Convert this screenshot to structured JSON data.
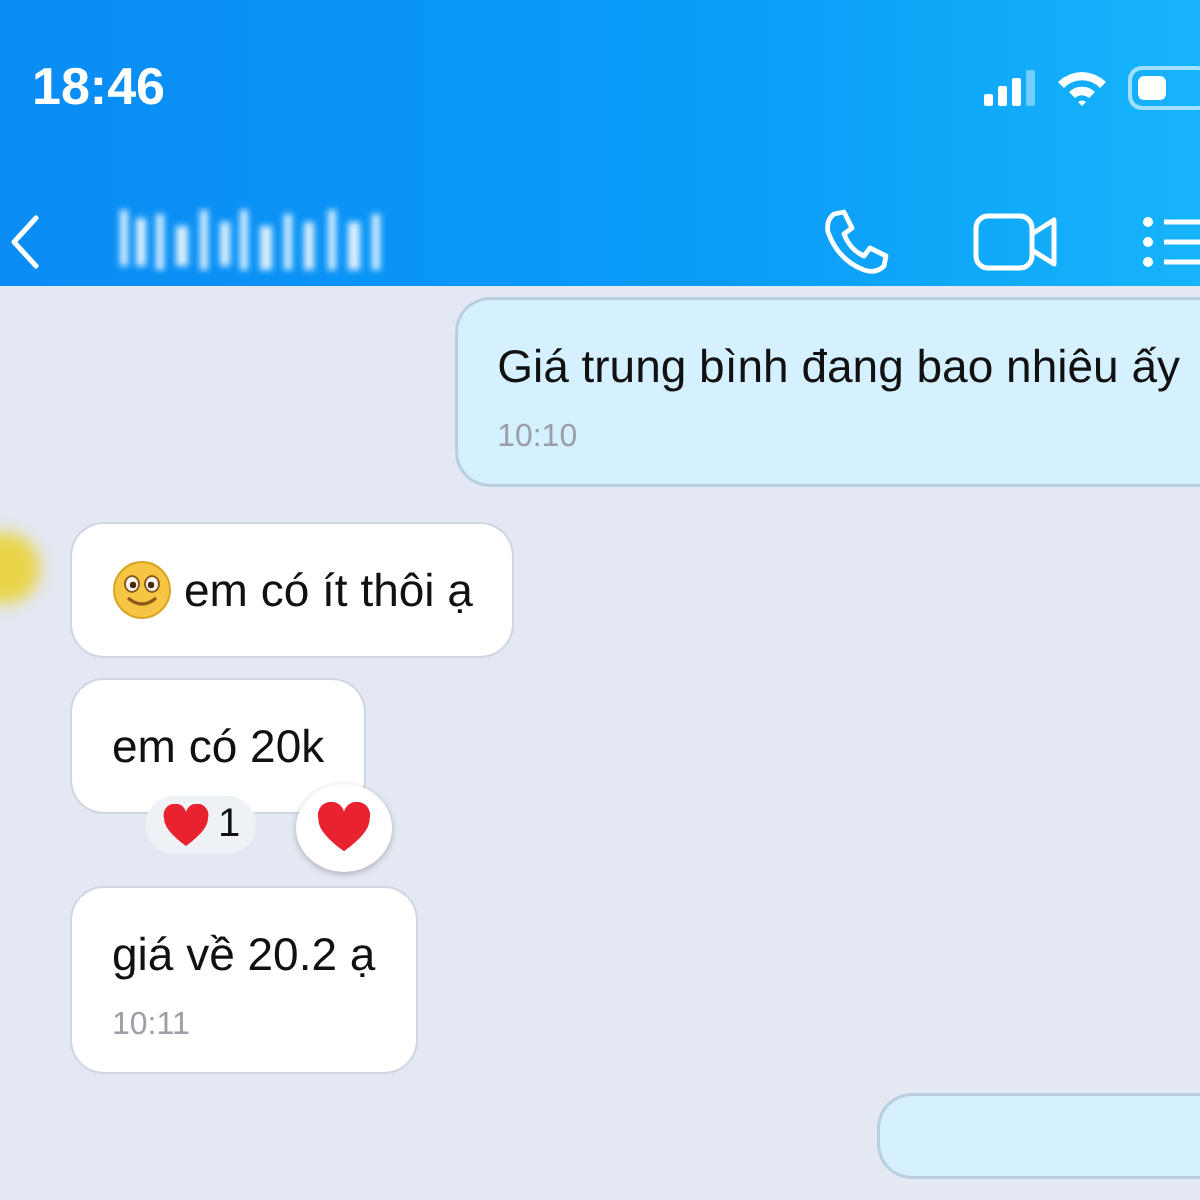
{
  "status_bar": {
    "time": "18:46"
  },
  "header": {
    "actions": [
      {
        "kind": "call"
      },
      {
        "kind": "video"
      },
      {
        "kind": "menu"
      }
    ]
  },
  "messages": [
    {
      "kind": "outgoing",
      "text": "Giá trung bình đang bao nhiêu ấy",
      "time": "10:10"
    },
    {
      "kind": "incoming",
      "avatar": true,
      "leading_emoji": true,
      "text": "em có ít thôi ạ"
    },
    {
      "kind": "incoming",
      "text": "em có 20k",
      "reaction_count": "1"
    },
    {
      "kind": "incoming",
      "text": "giá về 20.2 ạ",
      "time": "10:11"
    },
    {
      "kind": "outgoing"
    }
  ]
}
